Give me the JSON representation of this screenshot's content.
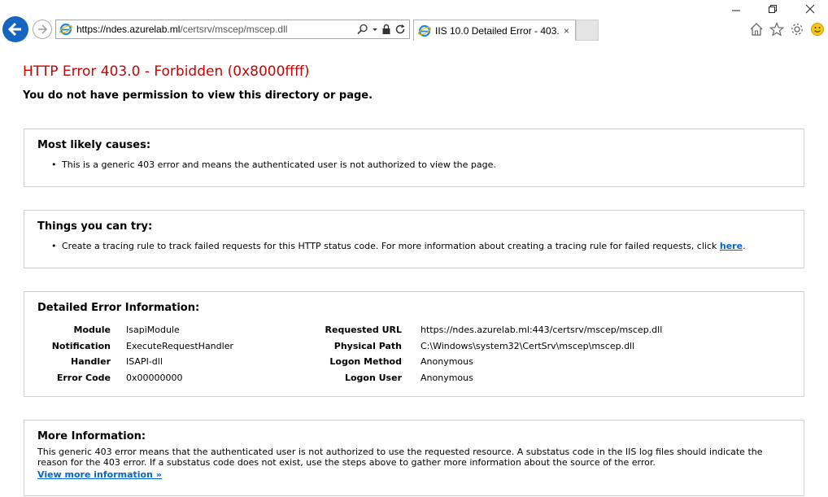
{
  "browser": {
    "url_host": "https://ndes.azurelab.ml",
    "url_path": "/certsrv/mscep/mscep.dll",
    "tab_title": "IIS 10.0 Detailed Error - 403....",
    "tab_close": "×"
  },
  "page": {
    "title": "HTTP Error 403.0 - Forbidden (0x8000ffff)",
    "subtitle": "You do not have permission to view this directory or page.",
    "causes": {
      "heading": "Most likely causes:",
      "items": [
        "This is a generic 403 error and means the authenticated user is not authorized to view the page."
      ]
    },
    "try": {
      "heading": "Things you can try:",
      "text": "Create a tracing rule to track failed requests for this HTTP status code. For more information about creating a tracing rule for failed requests, click ",
      "link": "here",
      "suffix": "."
    },
    "details": {
      "heading": "Detailed Error Information:",
      "left": [
        {
          "label": "Module",
          "value": "IsapiModule"
        },
        {
          "label": "Notification",
          "value": "ExecuteRequestHandler"
        },
        {
          "label": "Handler",
          "value": "ISAPI-dll"
        },
        {
          "label": "Error Code",
          "value": "0x00000000"
        }
      ],
      "right": [
        {
          "label": "Requested URL",
          "value": "https://ndes.azurelab.ml:443/certsrv/mscep/mscep.dll"
        },
        {
          "label": "Physical Path",
          "value": "C:\\Windows\\system32\\CertSrv\\mscep\\mscep.dll"
        },
        {
          "label": "Logon Method",
          "value": "Anonymous"
        },
        {
          "label": "Logon User",
          "value": "Anonymous"
        }
      ]
    },
    "more": {
      "heading": "More Information:",
      "text": "This generic 403 error means that the authenticated user is not authorized to use the requested resource. A substatus code in the IIS log files should indicate the reason for the 403 error. If a substatus code does not exist, use the steps above to gather more information about the source of the error.",
      "link": "View more information »"
    }
  },
  "colors": {
    "error_red": "#cc0000",
    "link_blue": "#0066cc",
    "back_button": "#1565c0"
  }
}
